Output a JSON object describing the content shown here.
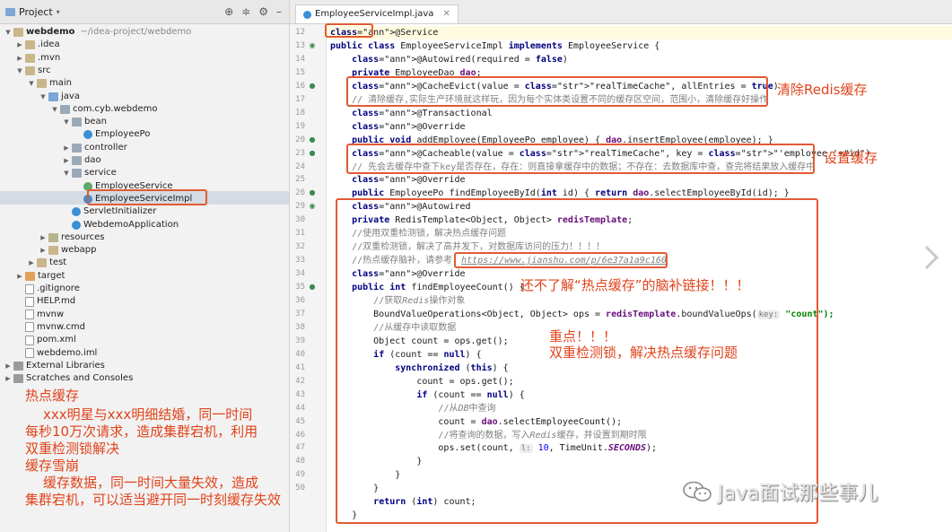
{
  "project_panel": {
    "title": "Project",
    "tree": [
      {
        "label": "webdemo",
        "sub": "~/idea-project/webdemo",
        "depth": 0,
        "arrow": "▼",
        "icon": "folder",
        "bold": true
      },
      {
        "label": ".idea",
        "depth": 1,
        "arrow": "▶",
        "icon": "folder"
      },
      {
        "label": ".mvn",
        "depth": 1,
        "arrow": "▶",
        "icon": "folder"
      },
      {
        "label": "src",
        "depth": 1,
        "arrow": "▼",
        "icon": "folder"
      },
      {
        "label": "main",
        "depth": 2,
        "arrow": "▼",
        "icon": "folder"
      },
      {
        "label": "java",
        "depth": 3,
        "arrow": "▼",
        "icon": "folder-src"
      },
      {
        "label": "com.cyb.webdemo",
        "depth": 4,
        "arrow": "▼",
        "icon": "folder-pkg"
      },
      {
        "label": "bean",
        "depth": 5,
        "arrow": "▼",
        "icon": "folder-pkg"
      },
      {
        "label": "EmployeePo",
        "depth": 6,
        "arrow": "",
        "icon": "cls"
      },
      {
        "label": "controller",
        "depth": 5,
        "arrow": "▶",
        "icon": "folder-pkg"
      },
      {
        "label": "dao",
        "depth": 5,
        "arrow": "▶",
        "icon": "folder-pkg"
      },
      {
        "label": "service",
        "depth": 5,
        "arrow": "▼",
        "icon": "folder-pkg"
      },
      {
        "label": "EmployeeService",
        "depth": 6,
        "arrow": "",
        "icon": "iface"
      },
      {
        "label": "EmployeeServiceImpl",
        "depth": 6,
        "arrow": "",
        "icon": "cls"
      },
      {
        "label": "ServletInitializer",
        "depth": 5,
        "arrow": "",
        "icon": "cls"
      },
      {
        "label": "WebdemoApplication",
        "depth": 5,
        "arrow": "",
        "icon": "cls"
      },
      {
        "label": "resources",
        "depth": 3,
        "arrow": "▶",
        "icon": "folder-res"
      },
      {
        "label": "webapp",
        "depth": 3,
        "arrow": "▶",
        "icon": "folder"
      },
      {
        "label": "test",
        "depth": 2,
        "arrow": "▶",
        "icon": "folder"
      },
      {
        "label": "target",
        "depth": 1,
        "arrow": "▶",
        "icon": "folder-ex"
      },
      {
        "label": ".gitignore",
        "depth": 1,
        "arrow": "",
        "icon": "file"
      },
      {
        "label": "HELP.md",
        "depth": 1,
        "arrow": "",
        "icon": "file"
      },
      {
        "label": "mvnw",
        "depth": 1,
        "arrow": "",
        "icon": "file"
      },
      {
        "label": "mvnw.cmd",
        "depth": 1,
        "arrow": "",
        "icon": "file"
      },
      {
        "label": "pom.xml",
        "depth": 1,
        "arrow": "",
        "icon": "file"
      },
      {
        "label": "webdemo.iml",
        "depth": 1,
        "arrow": "",
        "icon": "file"
      },
      {
        "label": "External Libraries",
        "depth": 0,
        "arrow": "▶",
        "icon": "lib"
      },
      {
        "label": "Scratches and Consoles",
        "depth": 0,
        "arrow": "▶",
        "icon": "lib"
      }
    ]
  },
  "left_notes": {
    "line1": "热点缓存",
    "line2": "xxx明星与xxx明细结婚，同一时间",
    "line3": "每秒10万次请求，造成集群宕机，利用",
    "line4": "双重检测锁解决",
    "line5": "缓存雪崩",
    "line6": "缓存数据，同一时间大量失效，造成",
    "line7": "集群宕机，可以适当避开同一时刻缓存失效"
  },
  "editor": {
    "tab_label": "EmployeeServiceImpl.java",
    "line_numbers": [
      "12",
      "13",
      "14",
      "15",
      "16",
      "17",
      "18",
      "19",
      "20",
      "23",
      "24",
      "25",
      "26",
      "29",
      "30",
      "31",
      "32",
      "33",
      "34",
      "35",
      "36",
      "37",
      "38",
      "39",
      "40",
      "41",
      "42",
      "43",
      "44",
      "45",
      "46",
      "47",
      "48",
      "49",
      "50"
    ],
    "code_lines": [
      "@Service",
      "public class EmployeeServiceImpl implements EmployeeService {",
      "    @Autowired(required = false)",
      "    private EmployeeDao dao;",
      "    @CacheEvict(value = \"realTimeCache\", allEntries = true)",
      "    // 清除缓存,实际生产环境就这样玩，因为每个实体类设置不同的缓存区空间，范围小，清除缓存好操作",
      "    @Transactional",
      "    @Override",
      "    public void addEmployee(EmployeePo employee) { dao.insertEmployee(employee); }",
      "    @Cacheable(value = \"realTimeCache\", key = \"'employee_'+#id\")",
      "    // 先会去缓存中查下key是否存在，存在：则直接拿缓存中的数据；不存在：去数据库中查，查完将结果放入缓存中",
      "    @Override",
      "    public EmployeePo findEmployeeById(int id) { return dao.selectEmployeeById(id); }",
      "    @Autowired",
      "    private RedisTemplate<Object, Object> redisTemplate;",
      "    //使用双重检测锁，解决热点缓存问题",
      "    //双重检测锁，解决了高并发下，对数据库访问的压力！！！！",
      "    //热点缓存脑补，请参考：",
      "    @Override",
      "    public int findEmployeeCount() {",
      "        //获取Redis操作对象",
      "        BoundValueOperations<Object, Object> ops = redisTemplate.boundValueOps(",
      "        //从缓存中读取数据",
      "        Object count = ops.get();",
      "        if (count == null) {",
      "            synchronized (this) {",
      "                count = ops.get();",
      "                if (count == null) {",
      "                    //从DB中查询",
      "                    count = dao.selectEmployeeCount();",
      "                    //将查询的数据，写入Redis缓存，并设置到期时限",
      "                    ops.set(count,",
      "                }",
      "            }",
      "        }",
      "        return (int) count;",
      "    }"
    ],
    "link_text": "https://www.jianshu.com/p/6e37a1a9c160",
    "hint_key": "key:",
    "key_value": "\"count\");",
    "hint_l": "l:",
    "set_tail": "10, TimeUnit.SECONDS);"
  },
  "right_notes": {
    "clear_cache": "清除Redis缓存",
    "set_cache": "设置缓存",
    "link_note": "还不了解“热点缓存”的脑补链接！！！",
    "key_point_1": "重点！！！",
    "key_point_2": "双重检测锁，解决热点缓存问题"
  },
  "watermark": {
    "text": "Java面试那些事儿"
  }
}
